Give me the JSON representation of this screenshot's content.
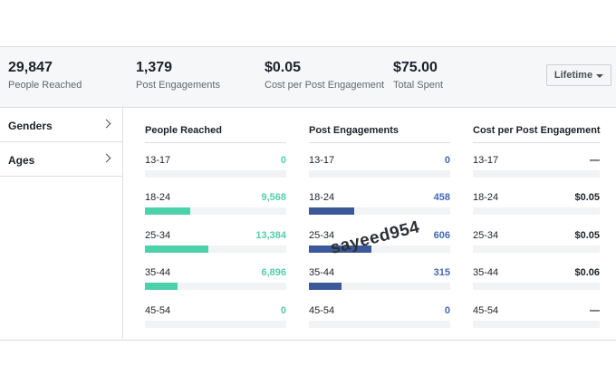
{
  "summary": {
    "people_reached": {
      "value": "29,847",
      "label": "People Reached"
    },
    "post_engagements": {
      "value": "1,379",
      "label": "Post Engagements"
    },
    "cost_per_engagement": {
      "value": "$0.05",
      "label": "Cost per Post Engagement"
    },
    "total_spent": {
      "value": "$75.00",
      "label": "Total Spent"
    }
  },
  "date_range": {
    "label": "Lifetime"
  },
  "sidebar": {
    "items": [
      {
        "label": "Genders"
      },
      {
        "label": "Ages"
      }
    ]
  },
  "columns": {
    "reach": {
      "title": "People Reached"
    },
    "engagement": {
      "title": "Post Engagements"
    },
    "cost": {
      "title": "Cost per Post Engagement"
    }
  },
  "rows": [
    {
      "age": "13-17",
      "reach": "0",
      "reach_fraction": 0,
      "engagement": "0",
      "engagement_fraction": 0,
      "cost": "—"
    },
    {
      "age": "18-24",
      "reach": "9,568",
      "reach_fraction": 0.32,
      "engagement": "458",
      "engagement_fraction": 0.32,
      "cost": "$0.05"
    },
    {
      "age": "25-34",
      "reach": "13,384",
      "reach_fraction": 0.45,
      "engagement": "606",
      "engagement_fraction": 0.44,
      "cost": "$0.05"
    },
    {
      "age": "35-44",
      "reach": "6,896",
      "reach_fraction": 0.23,
      "engagement": "315",
      "engagement_fraction": 0.23,
      "cost": "$0.06"
    },
    {
      "age": "45-54",
      "reach": "0",
      "reach_fraction": 0,
      "engagement": "0",
      "engagement_fraction": 0,
      "cost": "—"
    }
  ],
  "colors": {
    "reach_bar": "#4dd1aa",
    "engagement_bar": "#3b5998"
  },
  "watermark": "sayeed954"
}
